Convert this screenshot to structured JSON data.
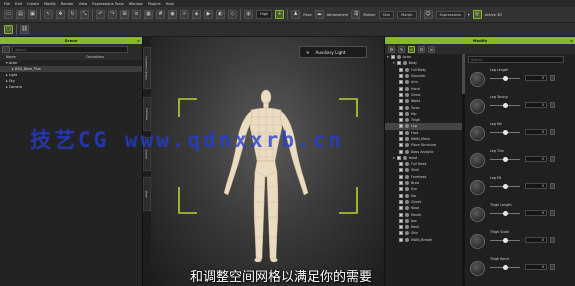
{
  "menubar": [
    "File",
    "Edit",
    "Create",
    "Modify",
    "Render",
    "View",
    "Expressions Tools",
    "Window",
    "Plugins",
    "Help"
  ],
  "toolbar": {
    "quality": "High",
    "buttons": [
      "Pose",
      "Atmosphere",
      "Motion",
      "Skin",
      "Morph"
    ],
    "select_label": "Expressions",
    "select2_label": "Animate",
    "last_label": "Active 3D"
  },
  "scene_panel": {
    "title": "Scene",
    "search_placeholder": "Search",
    "columns": [
      "Name",
      "Controllers"
    ],
    "rows": [
      "Actor",
      "DSD_Base_Plus",
      "Light",
      "Sky",
      "Camera"
    ]
  },
  "vtabs": [
    "Content Library",
    "Camera",
    "Scene",
    "View"
  ],
  "viewport": {
    "mode_badge": "Auxiliary Light"
  },
  "modify_panel": {
    "title": "Modify",
    "tree": [
      {
        "label": "Actor",
        "indent": 0
      },
      {
        "label": "Body",
        "indent": 1
      },
      {
        "label": "Full Body",
        "indent": 2
      },
      {
        "label": "Shoulder",
        "indent": 2
      },
      {
        "label": "Arm",
        "indent": 2
      },
      {
        "label": "Hand",
        "indent": 2
      },
      {
        "label": "Chest",
        "indent": 2
      },
      {
        "label": "Waist",
        "indent": 2
      },
      {
        "label": "Torso",
        "indent": 2
      },
      {
        "label": "Hip",
        "indent": 2
      },
      {
        "label": "Thigh",
        "indent": 2
      },
      {
        "label": "Leg",
        "indent": 2
      },
      {
        "label": "Foot",
        "indent": 2
      },
      {
        "label": "MAIN_Mesh",
        "indent": 2
      },
      {
        "label": "Place Structure",
        "indent": 2
      },
      {
        "label": "Baby Analytic",
        "indent": 2
      },
      {
        "label": "Head",
        "indent": 1
      },
      {
        "label": "Full Head",
        "indent": 2
      },
      {
        "label": "Skull",
        "indent": 2
      },
      {
        "label": "Forehead",
        "indent": 2
      },
      {
        "label": "Brow",
        "indent": 2
      },
      {
        "label": "Eye",
        "indent": 2
      },
      {
        "label": "Ear",
        "indent": 2
      },
      {
        "label": "Cheek",
        "indent": 2
      },
      {
        "label": "Nose",
        "indent": 2
      },
      {
        "label": "Mouth",
        "indent": 2
      },
      {
        "label": "Jaw",
        "indent": 2
      },
      {
        "label": "Neck",
        "indent": 2
      },
      {
        "label": "Skin",
        "indent": 2
      },
      {
        "label": "MAIN_Breath",
        "indent": 2
      }
    ],
    "slider_search_placeholder": "Search",
    "sliders": [
      {
        "label": "Leg Length",
        "value": "0",
        "level": 0.5
      },
      {
        "label": "Leg Toning",
        "value": "0",
        "level": 0.5
      },
      {
        "label": "Leg Fat",
        "value": "0",
        "level": 0.5
      },
      {
        "label": "Leg Thin",
        "value": "0",
        "level": 0.5
      },
      {
        "label": "Leg Fill",
        "value": "0",
        "level": 0.5
      },
      {
        "label": "Thigh Length",
        "value": "0",
        "level": 0.5
      },
      {
        "label": "Thigh Scale",
        "value": "0",
        "level": 0.5
      },
      {
        "label": "Thigh Bend",
        "value": "0",
        "level": 0.5
      }
    ]
  },
  "watermark": "技艺CG  www.qdnxxrb.cn",
  "subtitle": "和调整空间网格以满足你的需要"
}
